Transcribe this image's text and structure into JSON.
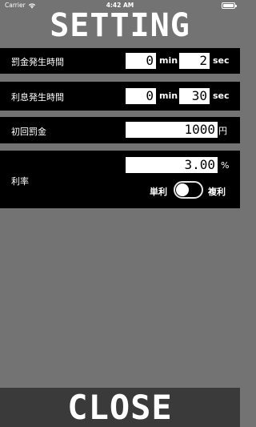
{
  "status": {
    "carrier": "Carrier",
    "time": "4:42 AM"
  },
  "title": "SETTING",
  "penalty_start": {
    "label": "罰金発生時間",
    "minutes": "0",
    "min_unit": "min",
    "seconds": "2",
    "sec_unit": "sec"
  },
  "interest_start": {
    "label": "利息発生時間",
    "minutes": "0",
    "min_unit": "min",
    "seconds": "30",
    "sec_unit": "sec"
  },
  "initial_fine": {
    "label": "初回罰金",
    "value": "1000",
    "unit": "円"
  },
  "rate": {
    "label": "利率",
    "value": "3.00",
    "unit": "%",
    "simple_label": "単利",
    "compound_label": "複利"
  },
  "close_label": "CLOSE"
}
